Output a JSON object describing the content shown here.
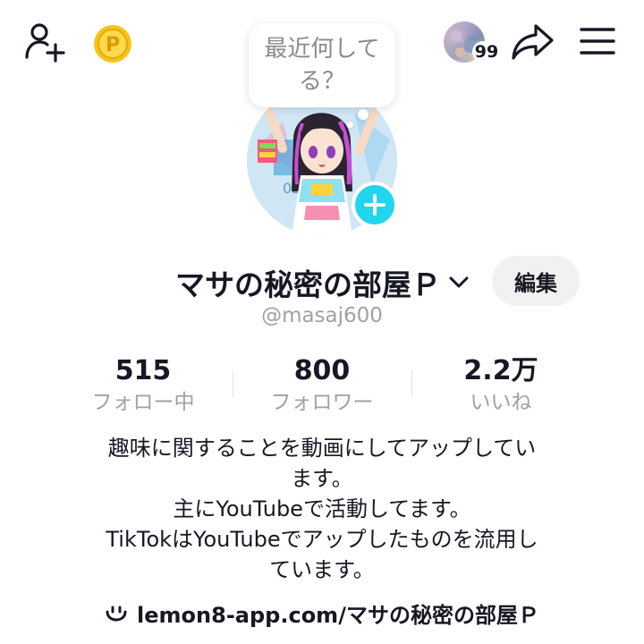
{
  "header": {
    "add_friend_icon": "person-add-icon",
    "coin_icon": "coin-icon",
    "coin_letter": "P",
    "notification_count": "99",
    "share_icon": "share-arrow-icon",
    "menu_icon": "hamburger-menu-icon"
  },
  "status_bubble": {
    "line1": "最近何して",
    "line2": "る？"
  },
  "profile": {
    "name": "マサの秘密の部屋Ｐ",
    "edit_label": "編集",
    "handle": "@masaj600"
  },
  "stats": [
    {
      "value": "515",
      "label": "フォロー中"
    },
    {
      "value": "800",
      "label": "フォロワー"
    },
    {
      "value": "2.2万",
      "label": "いいね"
    }
  ],
  "bio": {
    "lines": [
      "趣味に関することを動画にしてアップしてい",
      "ます。",
      "主にYouTubeで活動してます。",
      "TikTokはYouTubeでアップしたものを流用し",
      "ています。"
    ]
  },
  "link": {
    "text": "lemon8-app.com/マサの秘密の部屋Ｐ",
    "icon": "lemon8-smile-icon"
  },
  "colors": {
    "accent": "#20d5ec",
    "text": "#161823",
    "muted": "#a0a1a6",
    "button_bg": "#f1f1f2",
    "coin": "#f5c518"
  }
}
